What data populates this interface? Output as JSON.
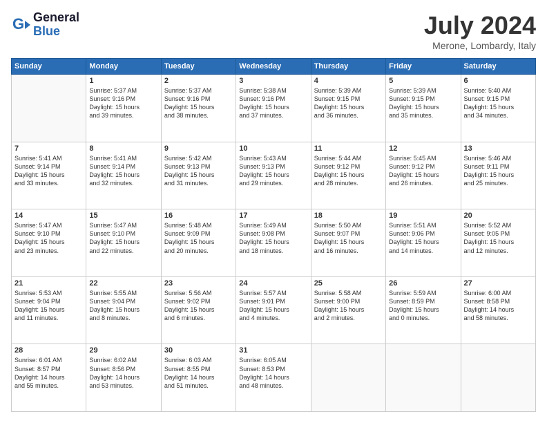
{
  "header": {
    "logo_line1": "General",
    "logo_line2": "Blue",
    "month": "July 2024",
    "location": "Merone, Lombardy, Italy"
  },
  "days_of_week": [
    "Sunday",
    "Monday",
    "Tuesday",
    "Wednesday",
    "Thursday",
    "Friday",
    "Saturday"
  ],
  "weeks": [
    [
      {
        "day": "",
        "content": ""
      },
      {
        "day": "1",
        "content": "Sunrise: 5:37 AM\nSunset: 9:16 PM\nDaylight: 15 hours\nand 39 minutes."
      },
      {
        "day": "2",
        "content": "Sunrise: 5:37 AM\nSunset: 9:16 PM\nDaylight: 15 hours\nand 38 minutes."
      },
      {
        "day": "3",
        "content": "Sunrise: 5:38 AM\nSunset: 9:16 PM\nDaylight: 15 hours\nand 37 minutes."
      },
      {
        "day": "4",
        "content": "Sunrise: 5:39 AM\nSunset: 9:15 PM\nDaylight: 15 hours\nand 36 minutes."
      },
      {
        "day": "5",
        "content": "Sunrise: 5:39 AM\nSunset: 9:15 PM\nDaylight: 15 hours\nand 35 minutes."
      },
      {
        "day": "6",
        "content": "Sunrise: 5:40 AM\nSunset: 9:15 PM\nDaylight: 15 hours\nand 34 minutes."
      }
    ],
    [
      {
        "day": "7",
        "content": "Sunrise: 5:41 AM\nSunset: 9:14 PM\nDaylight: 15 hours\nand 33 minutes."
      },
      {
        "day": "8",
        "content": "Sunrise: 5:41 AM\nSunset: 9:14 PM\nDaylight: 15 hours\nand 32 minutes."
      },
      {
        "day": "9",
        "content": "Sunrise: 5:42 AM\nSunset: 9:13 PM\nDaylight: 15 hours\nand 31 minutes."
      },
      {
        "day": "10",
        "content": "Sunrise: 5:43 AM\nSunset: 9:13 PM\nDaylight: 15 hours\nand 29 minutes."
      },
      {
        "day": "11",
        "content": "Sunrise: 5:44 AM\nSunset: 9:12 PM\nDaylight: 15 hours\nand 28 minutes."
      },
      {
        "day": "12",
        "content": "Sunrise: 5:45 AM\nSunset: 9:12 PM\nDaylight: 15 hours\nand 26 minutes."
      },
      {
        "day": "13",
        "content": "Sunrise: 5:46 AM\nSunset: 9:11 PM\nDaylight: 15 hours\nand 25 minutes."
      }
    ],
    [
      {
        "day": "14",
        "content": "Sunrise: 5:47 AM\nSunset: 9:10 PM\nDaylight: 15 hours\nand 23 minutes."
      },
      {
        "day": "15",
        "content": "Sunrise: 5:47 AM\nSunset: 9:10 PM\nDaylight: 15 hours\nand 22 minutes."
      },
      {
        "day": "16",
        "content": "Sunrise: 5:48 AM\nSunset: 9:09 PM\nDaylight: 15 hours\nand 20 minutes."
      },
      {
        "day": "17",
        "content": "Sunrise: 5:49 AM\nSunset: 9:08 PM\nDaylight: 15 hours\nand 18 minutes."
      },
      {
        "day": "18",
        "content": "Sunrise: 5:50 AM\nSunset: 9:07 PM\nDaylight: 15 hours\nand 16 minutes."
      },
      {
        "day": "19",
        "content": "Sunrise: 5:51 AM\nSunset: 9:06 PM\nDaylight: 15 hours\nand 14 minutes."
      },
      {
        "day": "20",
        "content": "Sunrise: 5:52 AM\nSunset: 9:05 PM\nDaylight: 15 hours\nand 12 minutes."
      }
    ],
    [
      {
        "day": "21",
        "content": "Sunrise: 5:53 AM\nSunset: 9:04 PM\nDaylight: 15 hours\nand 11 minutes."
      },
      {
        "day": "22",
        "content": "Sunrise: 5:55 AM\nSunset: 9:04 PM\nDaylight: 15 hours\nand 8 minutes."
      },
      {
        "day": "23",
        "content": "Sunrise: 5:56 AM\nSunset: 9:02 PM\nDaylight: 15 hours\nand 6 minutes."
      },
      {
        "day": "24",
        "content": "Sunrise: 5:57 AM\nSunset: 9:01 PM\nDaylight: 15 hours\nand 4 minutes."
      },
      {
        "day": "25",
        "content": "Sunrise: 5:58 AM\nSunset: 9:00 PM\nDaylight: 15 hours\nand 2 minutes."
      },
      {
        "day": "26",
        "content": "Sunrise: 5:59 AM\nSunset: 8:59 PM\nDaylight: 15 hours\nand 0 minutes."
      },
      {
        "day": "27",
        "content": "Sunrise: 6:00 AM\nSunset: 8:58 PM\nDaylight: 14 hours\nand 58 minutes."
      }
    ],
    [
      {
        "day": "28",
        "content": "Sunrise: 6:01 AM\nSunset: 8:57 PM\nDaylight: 14 hours\nand 55 minutes."
      },
      {
        "day": "29",
        "content": "Sunrise: 6:02 AM\nSunset: 8:56 PM\nDaylight: 14 hours\nand 53 minutes."
      },
      {
        "day": "30",
        "content": "Sunrise: 6:03 AM\nSunset: 8:55 PM\nDaylight: 14 hours\nand 51 minutes."
      },
      {
        "day": "31",
        "content": "Sunrise: 6:05 AM\nSunset: 8:53 PM\nDaylight: 14 hours\nand 48 minutes."
      },
      {
        "day": "",
        "content": ""
      },
      {
        "day": "",
        "content": ""
      },
      {
        "day": "",
        "content": ""
      }
    ]
  ]
}
